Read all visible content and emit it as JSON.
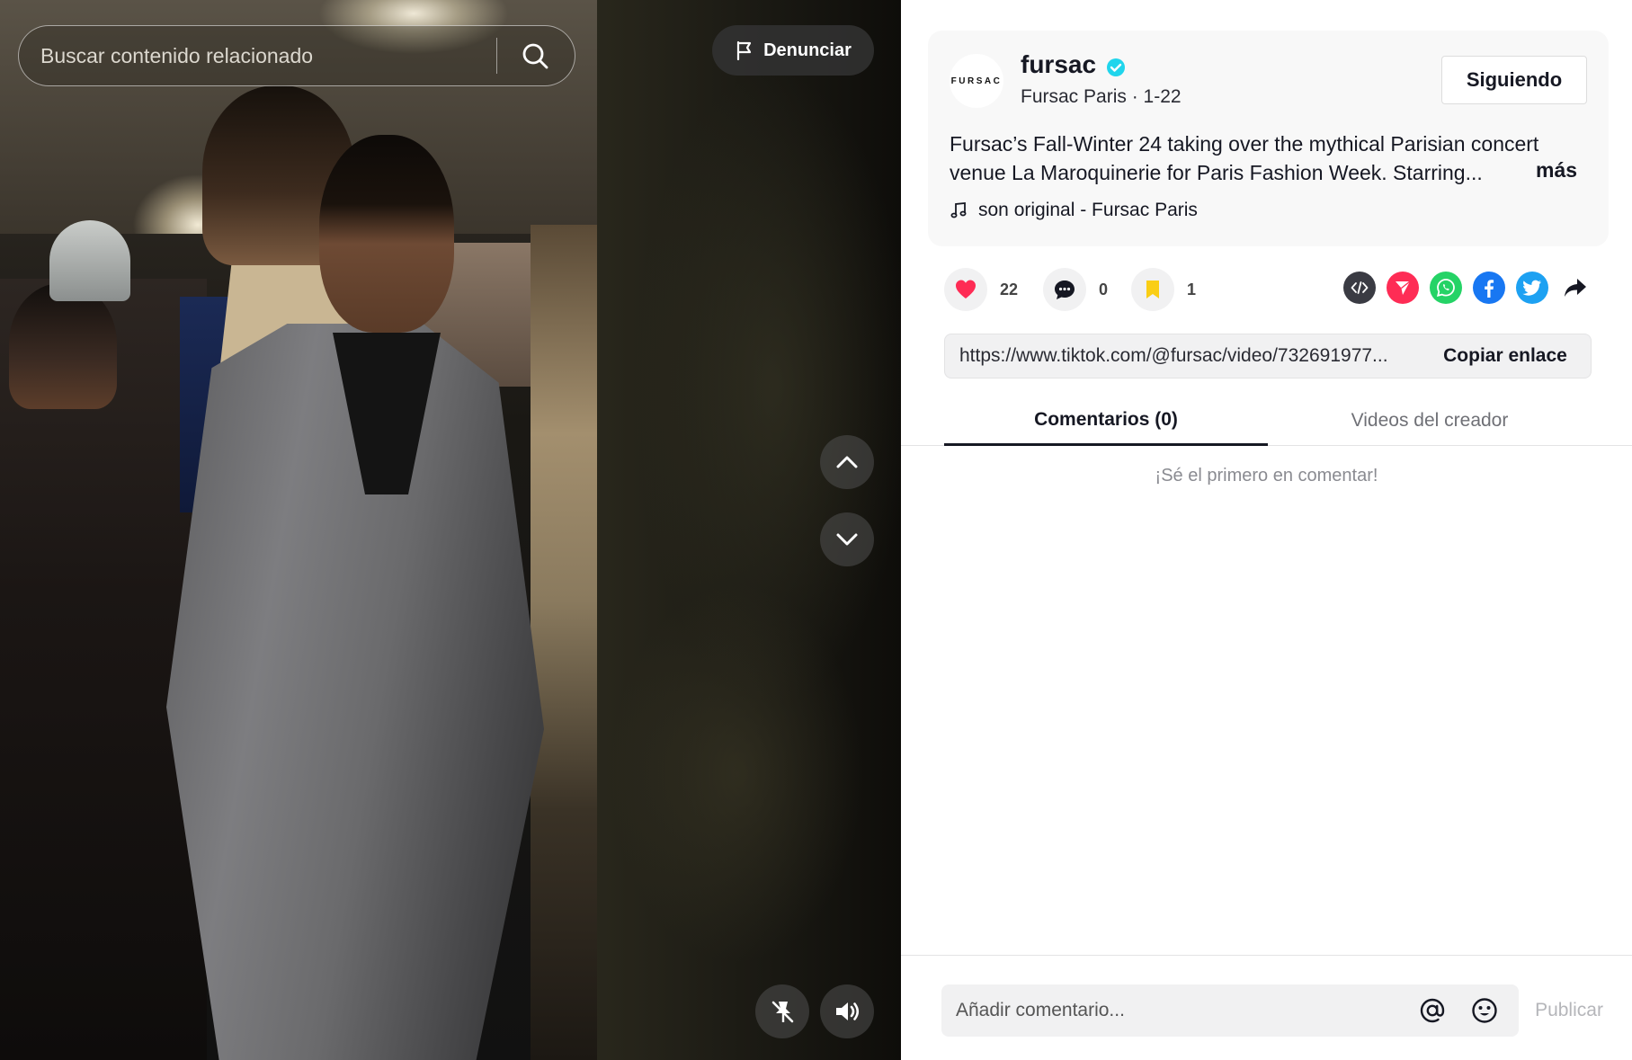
{
  "search": {
    "placeholder": "Buscar contenido relacionado",
    "icon": "search-icon"
  },
  "report": {
    "label": "Denunciar",
    "icon": "flag-icon"
  },
  "video_controls": {
    "up_icon": "chevron-up-icon",
    "down_icon": "chevron-down-icon",
    "pin_icon": "pin-off-icon",
    "volume_icon": "volume-icon"
  },
  "author": {
    "avatar_text": "FURSAC",
    "username": "fursac",
    "verified": true,
    "display_name": "Fursac Paris",
    "date": "1-22",
    "sub_line": "Fursac Paris · 1-22",
    "follow_label": "Siguiendo"
  },
  "description": {
    "text": "Fursac’s Fall-Winter 24 taking over the mythical Parisian concert venue La Maroquinerie for Paris Fashion Week. Starring...",
    "more_label": "más"
  },
  "music": {
    "icon": "music-note-icon",
    "label": "son original - Fursac Paris"
  },
  "actions": {
    "likes": "22",
    "comments": "0",
    "saves": "1"
  },
  "share": [
    "embed-icon",
    "send-icon",
    "whatsapp-icon",
    "facebook-icon",
    "twitter-icon",
    "share-arrow-icon"
  ],
  "link": {
    "url": "https://www.tiktok.com/@fursac/video/732691977...",
    "copy_label": "Copiar enlace"
  },
  "tabs": [
    {
      "label": "Comentarios (0)",
      "active": true
    },
    {
      "label": "Videos del creador",
      "active": false
    }
  ],
  "comments": {
    "empty_text": "¡Sé el primero en comentar!"
  },
  "comment_bar": {
    "placeholder": "Añadir comentario...",
    "publish_label": "Publicar"
  },
  "colors": {
    "like": "#fe2c55",
    "save": "#face15",
    "verified": "#20d5ec",
    "whatsapp": "#25d366",
    "facebook": "#1877f2",
    "twitter": "#1da1f2",
    "send": "#fe2c55"
  }
}
